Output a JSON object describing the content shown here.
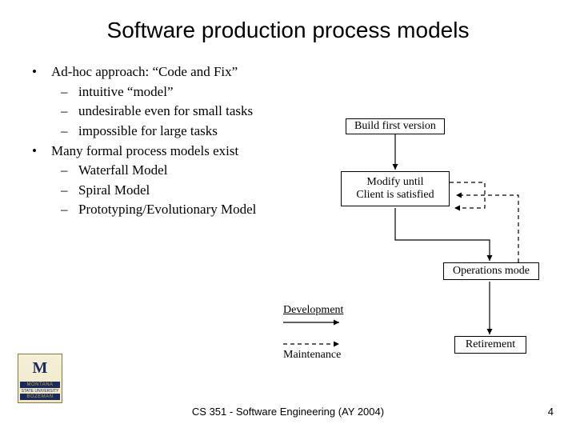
{
  "title": "Software production process models",
  "bullets": [
    {
      "text": "Ad-hoc approach: “Code and Fix”",
      "subs": [
        "intuitive “model”",
        "undesirable even for small tasks",
        "impossible for large tasks"
      ]
    },
    {
      "text": "Many formal process models exist",
      "subs": [
        "Waterfall Model",
        "Spiral Model",
        "Prototyping/Evolutionary Model"
      ]
    }
  ],
  "diagram": {
    "box1": "Build first version",
    "box2_line1": "Modify until",
    "box2_line2": "Client is satisfied",
    "box3": "Operations mode",
    "box4": "Retirement"
  },
  "legend": {
    "dev": "Development",
    "maint": "Maintenance"
  },
  "footer": "CS 351 - Software Engineering (AY 2004)",
  "page": "4",
  "logo": {
    "state": "MONTANA",
    "univ": "STATE UNIVERSITY",
    "city": "BOZEMAN"
  }
}
